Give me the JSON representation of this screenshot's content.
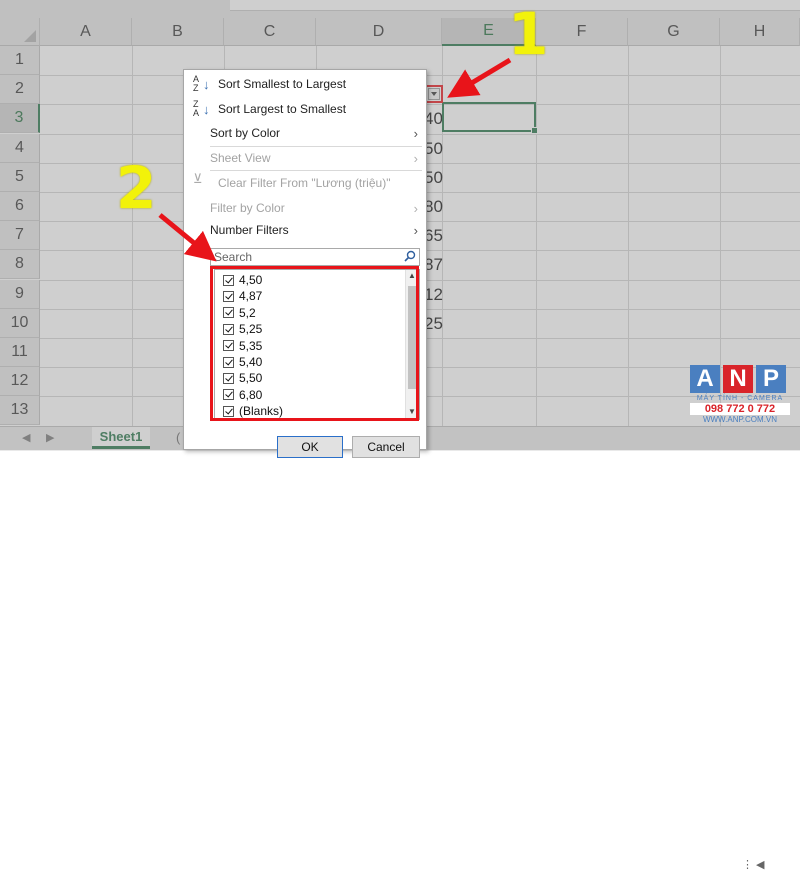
{
  "spreadsheet": {
    "columns": [
      "A",
      "B",
      "C",
      "D",
      "E",
      "F",
      "G",
      "H"
    ],
    "selected_column": "E",
    "rows": [
      "1",
      "2",
      "3",
      "4",
      "5",
      "6",
      "7",
      "8",
      "9",
      "10",
      "11",
      "12",
      "13"
    ],
    "selected_row": "3",
    "partial_values_column_d": [
      "40",
      "50",
      "50",
      "80",
      "65",
      "87",
      "12",
      "25"
    ],
    "row2_header_tail": "›"
  },
  "filter_menu": {
    "items": [
      {
        "label": "Sort Smallest to Largest",
        "icon": "sort-ascending-icon",
        "enabled": true
      },
      {
        "label": "Sort Largest to Smallest",
        "icon": "sort-descending-icon",
        "enabled": true
      },
      {
        "label": "Sort by Color",
        "enabled": true,
        "submenu": true
      },
      {
        "label": "Sheet View",
        "enabled": false,
        "submenu": true
      },
      {
        "label": "Clear Filter From \"Lương (triệu)\"",
        "icon": "clear-filter-icon",
        "enabled": false
      },
      {
        "label": "Filter by Color",
        "enabled": false,
        "submenu": true
      },
      {
        "label": "Number Filters",
        "enabled": true,
        "submenu": true
      }
    ],
    "search_placeholder": "Search",
    "values": [
      "4,50",
      "4,87",
      "5,2",
      "5,25",
      "5,35",
      "5,40",
      "5,50",
      "6,80",
      "(Blanks)"
    ],
    "ok_label": "OK",
    "cancel_label": "Cancel"
  },
  "sheet_tabs": {
    "active": "Sheet1",
    "add_glyph": "("
  },
  "annotations": {
    "step1": "1",
    "step2": "2",
    "highlight_color": "#e8141a",
    "number_color": "#f2f20a"
  },
  "watermark": {
    "letters": [
      "A",
      "N",
      "P"
    ],
    "letter_colors": [
      "#4a7fc0",
      "#d9242a",
      "#4a7fc0"
    ],
    "tagline": "MÁY TÍNH - CAMERA",
    "phone": "098 772 0 772",
    "website": "WWW.ANP.COM.VN"
  }
}
